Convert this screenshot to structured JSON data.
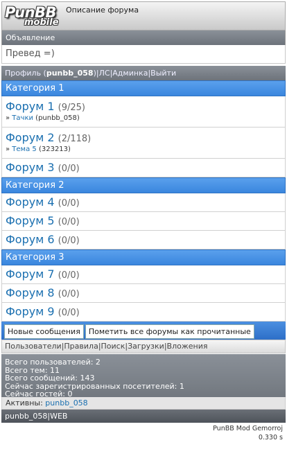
{
  "header": {
    "logo": "PunBB",
    "logo_sub": "mobile",
    "description": "Описание форума"
  },
  "announcement": {
    "title": "Объявление",
    "text": "Превед =)"
  },
  "profile_bar": {
    "prefix": "Профиль (",
    "user": "punbb_058",
    "suffix": ")",
    "sep": "|",
    "pm": "ЛС",
    "admin": "Админка",
    "logout": "Выйти"
  },
  "categories": [
    {
      "name": "Категория 1",
      "forums": [
        {
          "name": "Форум 1",
          "count": "(9/25)",
          "last_prefix": "» ",
          "last_topic": "Тачки",
          "last_info": " (punbb_058)"
        },
        {
          "name": "Форум 2",
          "count": "(2/118)",
          "last_prefix": "» ",
          "last_topic": "Тема 5",
          "last_info": " (323213)"
        },
        {
          "name": "Форум 3",
          "count": "(0/0)"
        }
      ]
    },
    {
      "name": "Категория 2",
      "forums": [
        {
          "name": "Форум 4",
          "count": "(0/0)"
        },
        {
          "name": "Форум 5",
          "count": "(0/0)"
        },
        {
          "name": "Форум 6",
          "count": "(0/0)"
        }
      ]
    },
    {
      "name": "Категория 3",
      "forums": [
        {
          "name": "Форум 7",
          "count": "(0/0)"
        },
        {
          "name": "Форум 8",
          "count": "(0/0)"
        },
        {
          "name": "Форум 9",
          "count": "(0/0)"
        }
      ]
    }
  ],
  "actions": {
    "new_posts": "Новые сообщения",
    "mark_read": "Пометить все форумы как прочитанные"
  },
  "links": {
    "users": "Пользователи",
    "rules": "Правила",
    "search": "Поиск",
    "downloads": "Загрузки",
    "attachments": "Вложения",
    "sep": "|"
  },
  "stats": {
    "users": "Всего пользователей: 2",
    "topics": "Всего тем: 11",
    "posts": "Всего сообщений: 143",
    "registered_online": "Сейчас зарегистрированных посетителей: 1",
    "guests_online": "Сейчас гостей: 0"
  },
  "active": {
    "label": "Активны: ",
    "user": "punbb_058"
  },
  "footer": {
    "user": "punbb_058",
    "sep": "|",
    "web": "WEB",
    "powered": "PunBB Mod Gemorroj",
    "time": "0.330 s"
  },
  "colors": {
    "category_blue": "#3a86de",
    "bar_gray": "#7a8088",
    "link": "#1a6fb0"
  }
}
